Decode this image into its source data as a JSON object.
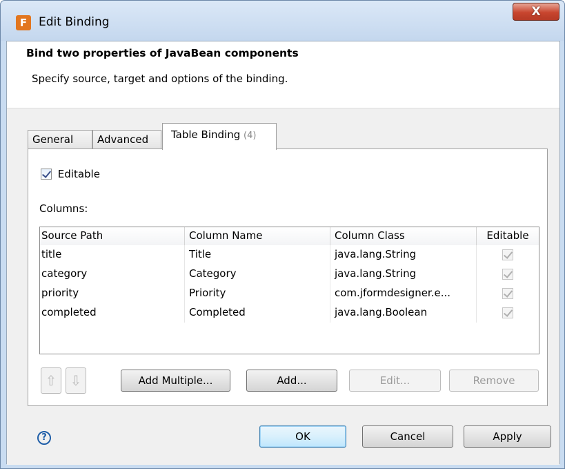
{
  "window": {
    "title": "Edit Binding",
    "close_label": "X"
  },
  "header": {
    "title": "Bind two properties of JavaBean components",
    "description": "Specify source, target and options of the binding."
  },
  "tabs": [
    {
      "label": "General",
      "active": false
    },
    {
      "label": "Advanced",
      "active": false
    },
    {
      "label": "Table Binding",
      "count": "(4)",
      "active": true
    }
  ],
  "table_binding": {
    "editable_label": "Editable",
    "editable_checked": true,
    "columns_label": "Columns:",
    "headers": [
      "Source Path",
      "Column Name",
      "Column Class",
      "Editable"
    ],
    "rows": [
      {
        "source_path": "title",
        "column_name": "Title",
        "column_class": "java.lang.String",
        "editable": true
      },
      {
        "source_path": "category",
        "column_name": "Category",
        "column_class": "java.lang.String",
        "editable": true
      },
      {
        "source_path": "priority",
        "column_name": "Priority",
        "column_class": "com.jformdesigner.e...",
        "editable": true
      },
      {
        "source_path": "completed",
        "column_name": "Completed",
        "column_class": "java.lang.Boolean",
        "editable": true
      }
    ],
    "buttons": {
      "move_up_icon": "arrow-up-icon",
      "move_down_icon": "arrow-down-icon",
      "add_multiple": "Add Multiple...",
      "add": "Add...",
      "edit": "Edit...",
      "remove": "Remove"
    }
  },
  "footer": {
    "help_icon": "help-icon",
    "ok": "OK",
    "cancel": "Cancel",
    "apply": "Apply"
  },
  "colors": {
    "titlebar": "#c4d7ee",
    "close_button": "#c8452e",
    "app_icon": "#e2761f",
    "default_button_border": "#3c7fb1"
  }
}
